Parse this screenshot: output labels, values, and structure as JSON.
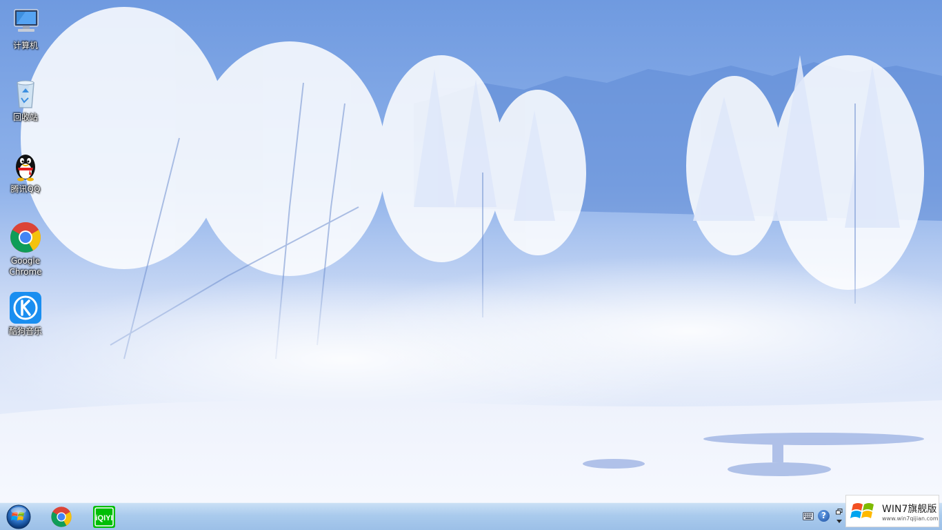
{
  "desktop": {
    "icons": [
      {
        "label": "计算机",
        "icon": "computer-icon"
      },
      {
        "label": "回收站",
        "icon": "recycle-bin-icon"
      },
      {
        "label": "腾讯QQ",
        "icon": "qq-penguin-icon"
      },
      {
        "label": "Google\nChrome",
        "icon": "chrome-icon"
      },
      {
        "label": "酷狗音乐",
        "icon": "kugou-music-icon"
      }
    ]
  },
  "taskbar": {
    "pinned": [
      {
        "icon": "chrome-icon"
      },
      {
        "icon": "iqiyi-icon",
        "label": "iQIYI"
      }
    ],
    "tray": [
      {
        "icon": "keyboard-icon"
      },
      {
        "icon": "help-icon",
        "label": "?"
      },
      {
        "icon": "restore-window-icon"
      }
    ]
  },
  "watermark": {
    "title": "WIN7旗舰版",
    "url": "www.win7qijian.com"
  },
  "colors": {
    "sky": "#7aa3e0",
    "snow": "#f7f9fe",
    "taskbar": "#a5c8ec",
    "iqiyi_green": "#00be06",
    "kugou_blue": "#1a8ef0"
  }
}
